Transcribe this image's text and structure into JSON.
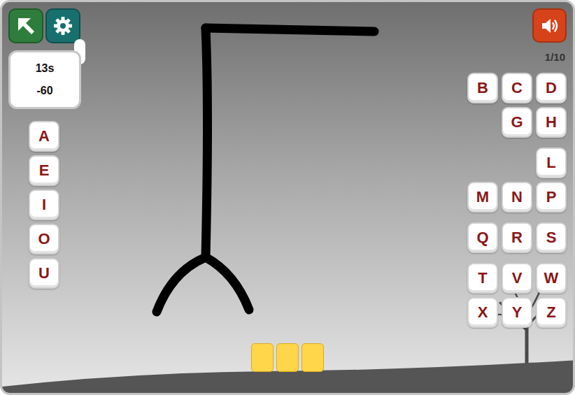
{
  "timer": {
    "time": "13s",
    "score": "-60"
  },
  "progress": "1/10",
  "vowels": [
    "A",
    "E",
    "I",
    "O",
    "U"
  ],
  "consonant_groups": [
    [
      [
        "B",
        "C",
        "D"
      ],
      [
        "",
        "G",
        "H"
      ]
    ],
    [
      [
        "",
        "",
        "L"
      ],
      [
        "M",
        "N",
        "P"
      ]
    ],
    [
      [
        "Q",
        "R",
        "S"
      ]
    ],
    [
      [
        "T",
        "V",
        "W"
      ],
      [
        "X",
        "Y",
        "Z"
      ]
    ]
  ],
  "word": {
    "letters": [
      "",
      "",
      ""
    ]
  }
}
